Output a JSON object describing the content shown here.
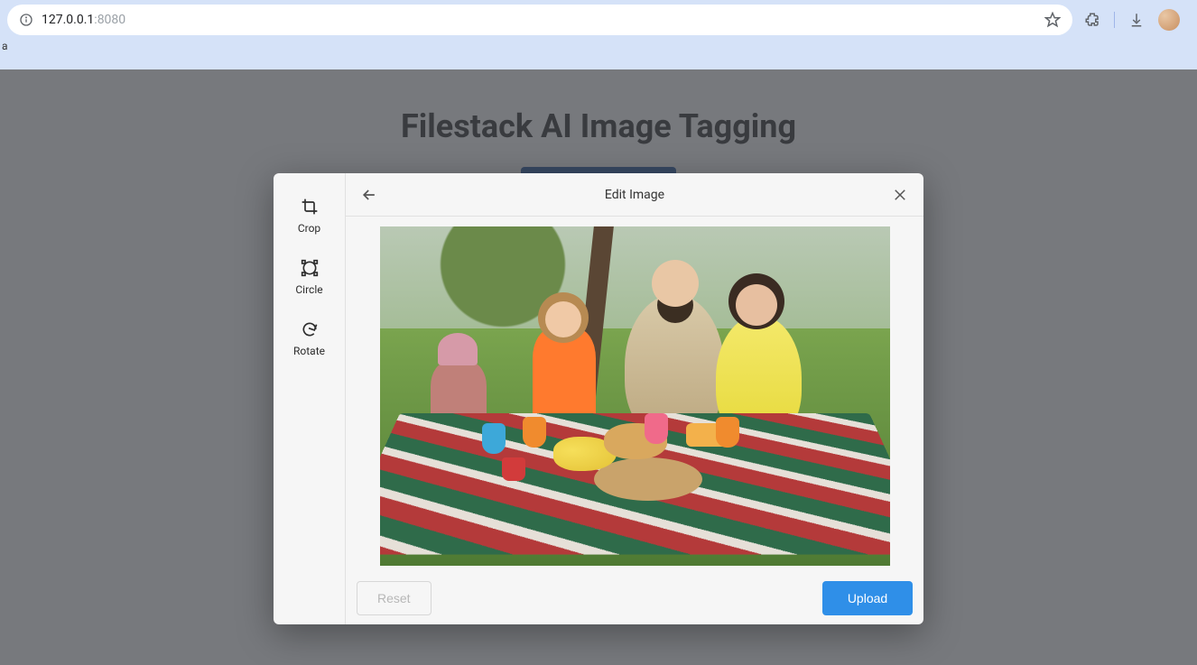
{
  "browser": {
    "url_host": "127.0.0.1",
    "url_port": ":8080",
    "sub_text": "a"
  },
  "page": {
    "title": "Filestack AI Image Tagging"
  },
  "modal": {
    "title": "Edit Image",
    "tools": [
      {
        "label": "Crop",
        "icon": "crop-icon"
      },
      {
        "label": "Circle",
        "icon": "circle-icon"
      },
      {
        "label": "Rotate",
        "icon": "rotate-icon"
      }
    ],
    "buttons": {
      "reset": "Reset",
      "upload": "Upload"
    }
  }
}
